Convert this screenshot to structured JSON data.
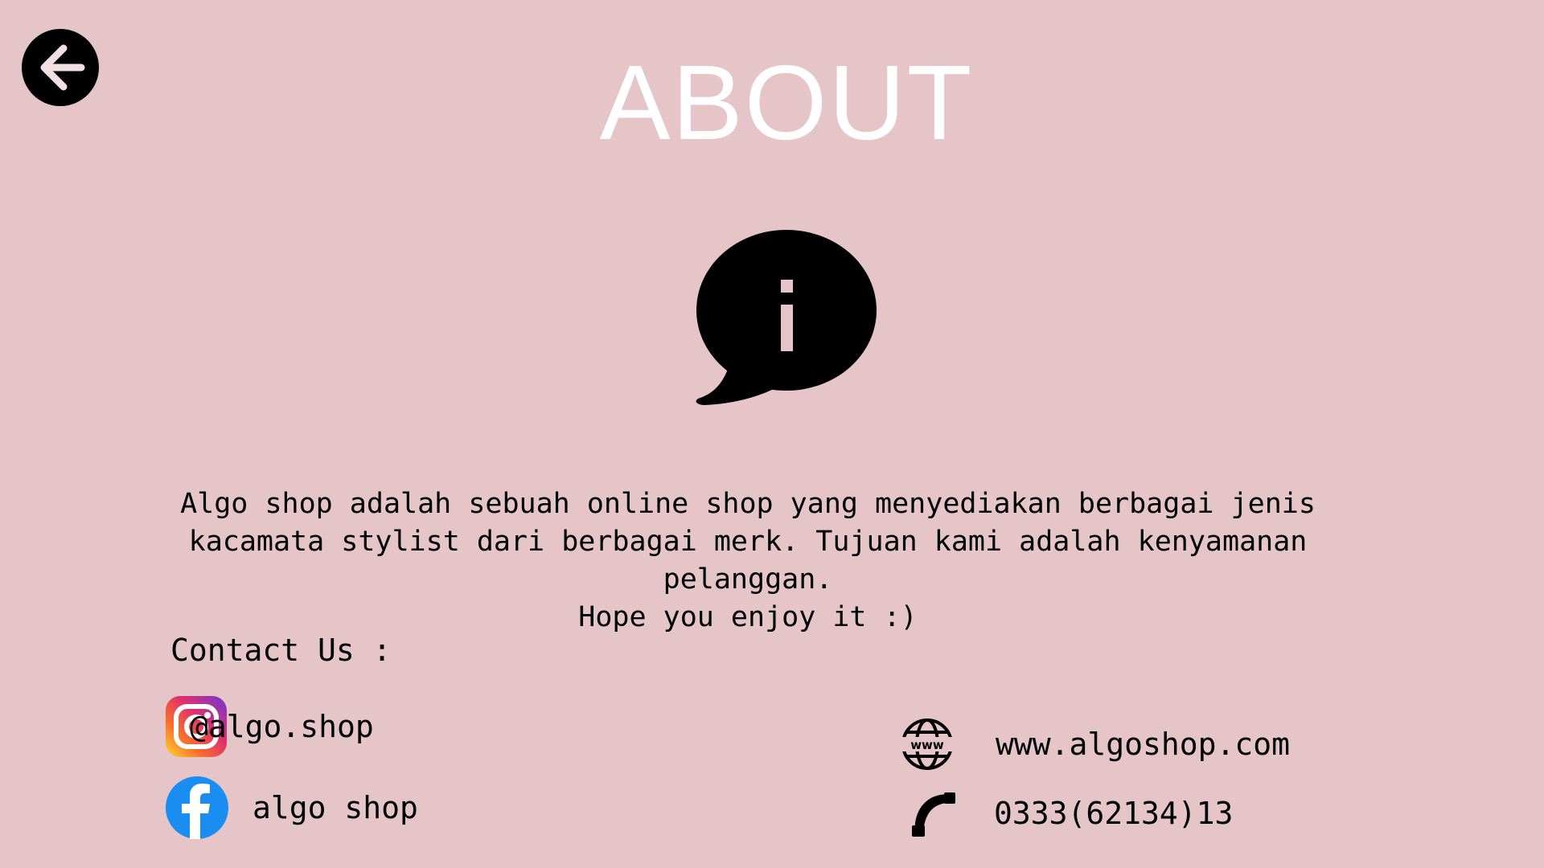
{
  "header": {
    "title": "ABOUT",
    "back_icon": "arrow-left-icon"
  },
  "hero": {
    "icon": "info-speech-bubble-icon"
  },
  "about": {
    "description": "Algo shop adalah sebuah online shop yang menyediakan berbagai jenis\nkacamata stylist dari berbagai merk. Tujuan kami adalah kenyamanan pelanggan.\nHope you enjoy it :)"
  },
  "contact": {
    "title": "Contact Us :",
    "instagram": {
      "icon": "instagram-icon",
      "label": "@algo.shop"
    },
    "facebook": {
      "icon": "facebook-icon",
      "label": "algo shop"
    },
    "website": {
      "icon": "globe-www-icon",
      "label": "www.algoshop.com"
    },
    "phone": {
      "icon": "phone-icon",
      "label": "0333(62134)13"
    }
  },
  "colors": {
    "background": "#e6c5c8",
    "title": "#ffffff",
    "text": "#000000",
    "facebook": "#1a8df0"
  }
}
